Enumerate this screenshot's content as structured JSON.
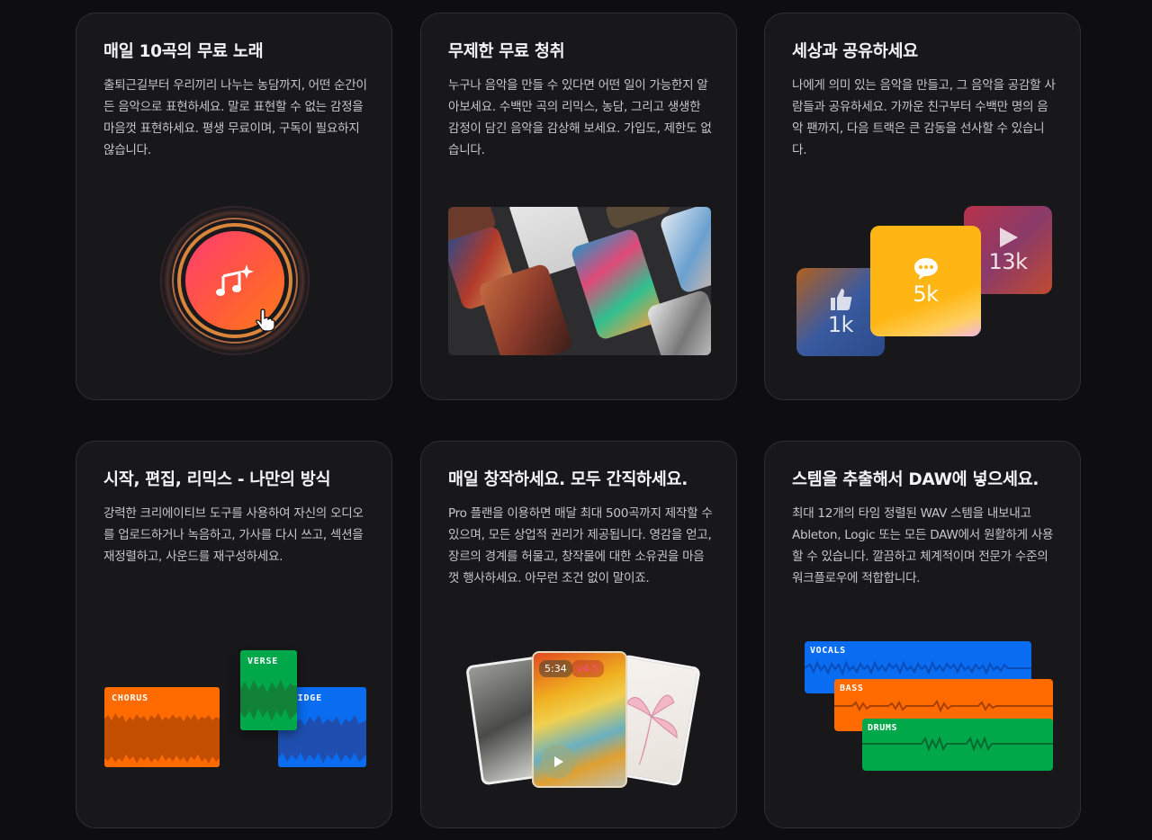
{
  "cards": [
    {
      "title": "매일 10곡의 무료 노래",
      "body": "출퇴근길부터 우리끼리 나누는 농담까지, 어떤 순간이든 음악으로 표현하세요. 말로 표현할 수 없는 감정을 마음껏 표현하세요. 평생 무료이며, 구독이 필요하지 않습니다."
    },
    {
      "title": "무제한 무료 청취",
      "body": "누구나 음악을 만들 수 있다면 어떤 일이 가능한지 알아보세요. 수백만 곡의 리믹스, 농담, 그리고 생생한 감정이 담긴 음악을 감상해 보세요. 가입도, 제한도 없습니다."
    },
    {
      "title": "세상과 공유하세요",
      "body": "나에게 의미 있는 음악을 만들고, 그 음악을 공감할 사람들과 공유하세요. 가까운 친구부터 수백만 명의 음악 팬까지, 다음 트랙은 큰 감동을 선사할 수 있습니다.",
      "stats": {
        "likes": "1k",
        "comments": "5k",
        "plays": "13k"
      }
    },
    {
      "title": "시작, 편집, 리믹스 - 나만의 방식",
      "body": "강력한 크리에이티브 도구를 사용하여 자신의 오디오를 업로드하거나 녹음하고, 가사를 다시 쓰고, 섹션을 재정렬하고, 사운드를 재구성하세요.",
      "tracks": {
        "chorus": "CHORUS",
        "verse": "VERSE",
        "bridge": "BRIDGE"
      }
    },
    {
      "title": "매일 창작하세요. 모두 간직하세요.",
      "body": "Pro 플랜을 이용하면 매달 최대 500곡까지 제작할 수 있으며, 모든 상업적 권리가 제공됩니다. 영감을 얻고, 장르의 경계를 허물고, 창작물에 대한 소유권을 마음껏 행사하세요. 아무런 조건 없이 말이죠.",
      "song": {
        "duration": "5:34",
        "version": "v4.5"
      }
    },
    {
      "title": "스템을 추출해서 DAW에 넣으세요.",
      "body": "최대 12개의 타임 정렬된 WAV 스템을 내보내고 Ableton, Logic 또는 모든 DAW에서 원활하게 사용할 수 있습니다. 깔끔하고 체계적이며 전문가 수준의 워크플로우에 적합합니다.",
      "stems": {
        "vocals": "VOCALS",
        "bass": "BASS",
        "drums": "DRUMS"
      }
    }
  ],
  "colors": {
    "background": "#0e0e10",
    "card": "#18181b",
    "orange": "#ff6b00",
    "blue": "#0a6cf0",
    "green": "#00a84a",
    "yellow": "#ffb614"
  }
}
